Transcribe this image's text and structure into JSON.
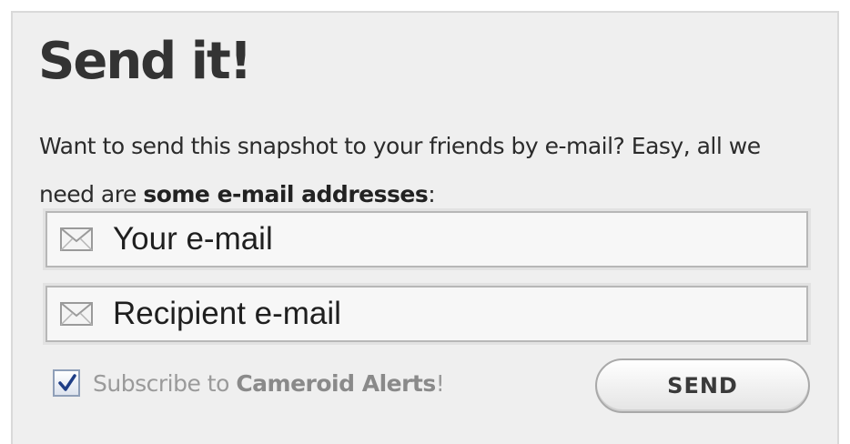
{
  "form": {
    "title": "Send it!",
    "desc_text": "Want to send this snapshot to your friends by e-mail? Easy, all we need are ",
    "desc_bold": "some e-mail addresses",
    "desc_end": ":",
    "your_email": {
      "placeholder": "Your e-mail",
      "value": ""
    },
    "recipient_email": {
      "placeholder": "Recipient e-mail",
      "value": ""
    },
    "subscribe": {
      "checked": true,
      "prefix": "Subscribe to ",
      "brand": "Cameroid Alerts",
      "suffix": "!"
    },
    "send_label": "SEND"
  },
  "icons": {
    "field_icon": "envelope-icon",
    "check_icon": "checkmark-icon"
  },
  "colors": {
    "panel_bg": "#efefef",
    "title": "#333333",
    "check_mark": "#1f3e86",
    "subscribe_text": "#9a9a9a"
  }
}
